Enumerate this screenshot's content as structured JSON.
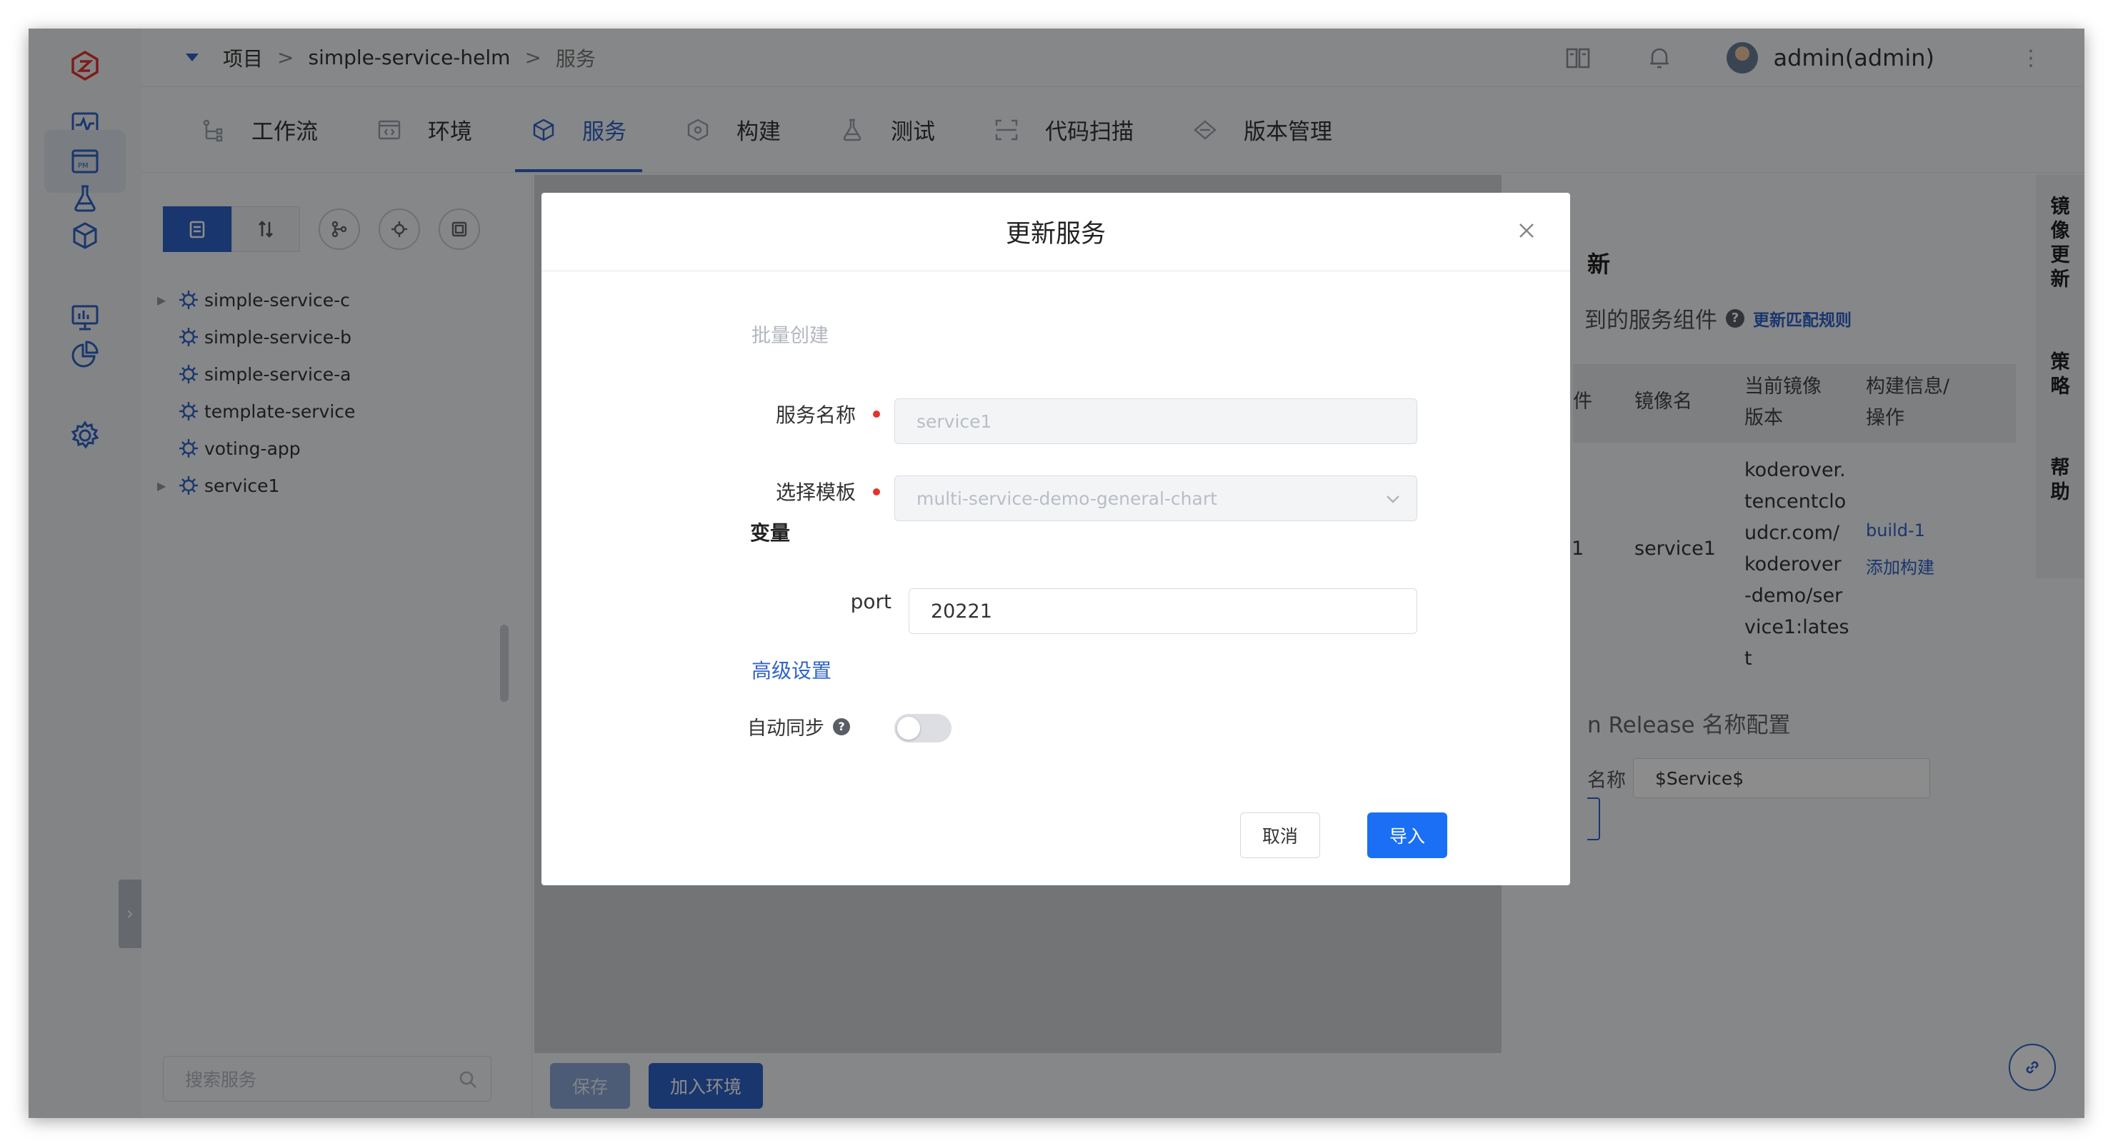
{
  "breadcrumb": {
    "items": [
      "项目",
      "simple-service-helm",
      "服务"
    ],
    "separator": ">"
  },
  "user": {
    "name": "admin(admin)"
  },
  "tabs": [
    {
      "label": "工作流",
      "icon": "workflow-icon"
    },
    {
      "label": "环境",
      "icon": "environment-icon"
    },
    {
      "label": "服务",
      "icon": "service-icon",
      "active": true
    },
    {
      "label": "构建",
      "icon": "build-icon"
    },
    {
      "label": "测试",
      "icon": "test-flask-icon"
    },
    {
      "label": "代码扫描",
      "icon": "code-scan-icon"
    },
    {
      "label": "版本管理",
      "icon": "version-icon"
    }
  ],
  "services": [
    {
      "name": "simple-service-c",
      "expandable": true
    },
    {
      "name": "simple-service-b",
      "expandable": false
    },
    {
      "name": "simple-service-a",
      "expandable": false
    },
    {
      "name": "template-service",
      "expandable": false
    },
    {
      "name": "voting-app",
      "expandable": false
    },
    {
      "name": "service1",
      "expandable": true
    }
  ],
  "search": {
    "placeholder": "搜索服务"
  },
  "bottom": {
    "save": "保存",
    "add_env": "加入环境"
  },
  "right_panel": {
    "title_fragment": "新",
    "subtitle": "到的服务组件",
    "match_rule_link": "更新匹配规则",
    "columns": [
      "件",
      "镜像名",
      "当前镜像\n版本",
      "构建信息/\n操作"
    ],
    "row": {
      "component": "1",
      "image_name": "service1",
      "image_version": "koderover.\ntencentclo\nudcr.com/\nkoderover\n-demo/ser\nvice1:lates\nt",
      "build": "build-1",
      "add_build": "添加构建"
    },
    "release_title": "n Release 名称配置",
    "release_label": "名称",
    "release_value": "$Service$"
  },
  "side_tabs": [
    "镜像更新",
    "策略",
    "帮助"
  ],
  "modal": {
    "title": "更新服务",
    "batch_label": "批量创建",
    "service_name_label": "服务名称",
    "service_name_value": "service1",
    "template_label": "选择模板",
    "template_value": "multi-service-demo-general-chart",
    "vars_label": "变量",
    "port_label": "port",
    "port_value": "20221",
    "advanced": "高级设置",
    "auto_sync": "自动同步",
    "auto_sync_enabled": false,
    "cancel": "取消",
    "import": "导入"
  },
  "colors": {
    "accent": "#2f63c8",
    "primary_button": "#1a6ff5",
    "required": "#e5322d"
  }
}
